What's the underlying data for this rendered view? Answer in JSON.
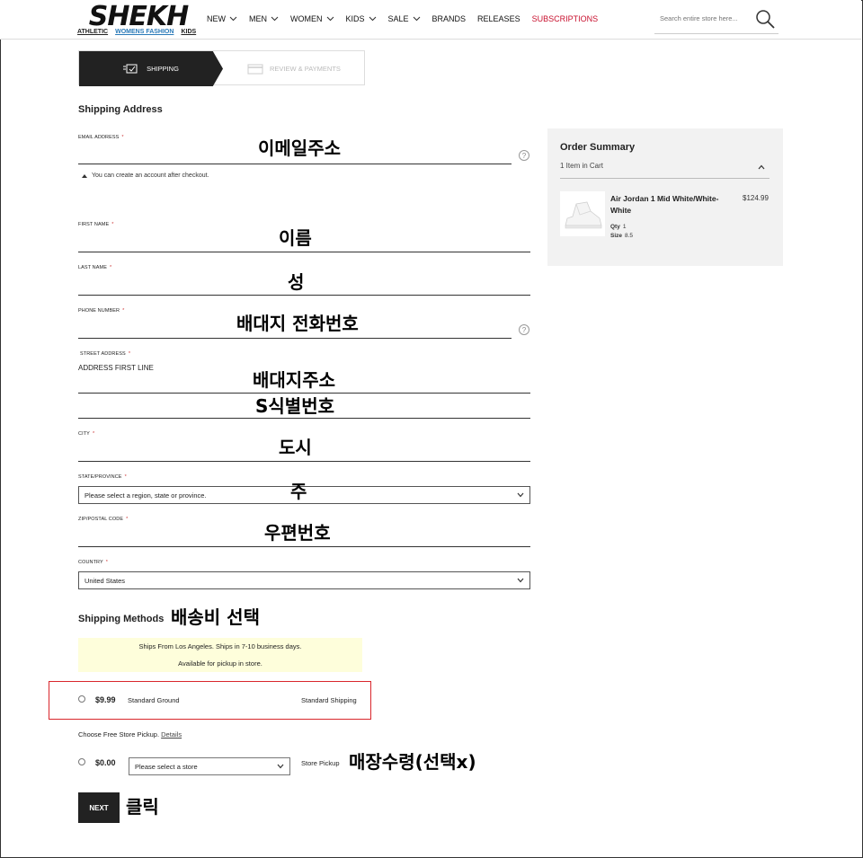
{
  "header": {
    "logo_text": "SHEKH",
    "sub_links": [
      "ATHLETIC",
      "WOMENS FASHION",
      "KIDS"
    ],
    "nav": [
      {
        "label": "NEW",
        "dropdown": true
      },
      {
        "label": "MEN",
        "dropdown": true
      },
      {
        "label": "WOMEN",
        "dropdown": true
      },
      {
        "label": "KIDS",
        "dropdown": true
      },
      {
        "label": "SALE",
        "dropdown": true
      },
      {
        "label": "BRANDS",
        "dropdown": false
      },
      {
        "label": "RELEASES",
        "dropdown": false
      },
      {
        "label": "SUBSCRIPTIONS",
        "dropdown": false,
        "color": "#c8102e"
      }
    ],
    "search_placeholder": "Search entire store here..."
  },
  "steps": {
    "active": "SHIPPING",
    "inactive": "REVIEW & PAYMENTS"
  },
  "shipping_address": {
    "title": "Shipping Address",
    "email_label": "EMAIL ADDRESS",
    "email_note": "You can create an account after checkout.",
    "first_name_label": "FIRST NAME",
    "last_name_label": "LAST NAME",
    "phone_label": "PHONE NUMBER",
    "street_label": "STREET ADDRESS",
    "street_line1_placeholder": "ADDRESS FIRST LINE",
    "city_label": "CITY",
    "state_label": "STATE/PROVINCE",
    "state_value": "Please select a region, state or province.",
    "zip_label": "ZIP/POSTAL CODE",
    "country_label": "COUNTRY",
    "country_value": "United States",
    "required_mark": "*"
  },
  "shipping_methods": {
    "title": "Shipping Methods",
    "info_line1": "Ships From Los Angeles. Ships in 7-10 business days.",
    "info_line2": "Available for pickup in store.",
    "option1": {
      "price": "$9.99",
      "name": "Standard Ground",
      "carrier": "Standard Shipping"
    },
    "pickup_text": "Choose Free Store Pickup.",
    "pickup_link": "Details",
    "option2": {
      "price": "$0.00",
      "store_select": "Please select a store",
      "carrier": "Store Pickup"
    },
    "next_label": "NEXT"
  },
  "order_summary": {
    "title": "Order Summary",
    "count": "1 Item in Cart",
    "product_name": "Air Jordan 1 Mid White/White-White",
    "product_price": "$124.99",
    "qty_label": "Qty",
    "qty_value": "1",
    "size_label": "Size",
    "size_value": "8.5"
  },
  "annotations": {
    "email": "이메일주소",
    "first_name": "이름",
    "last_name": "성",
    "phone": "배대지 전화번호",
    "street1": "배대지주소",
    "street2": "S식별번호",
    "city": "도시",
    "state": "주",
    "zip": "우편번호",
    "shipping": "배송비 선택",
    "pickup": "매장수령(선택x)",
    "next": "클릭"
  }
}
